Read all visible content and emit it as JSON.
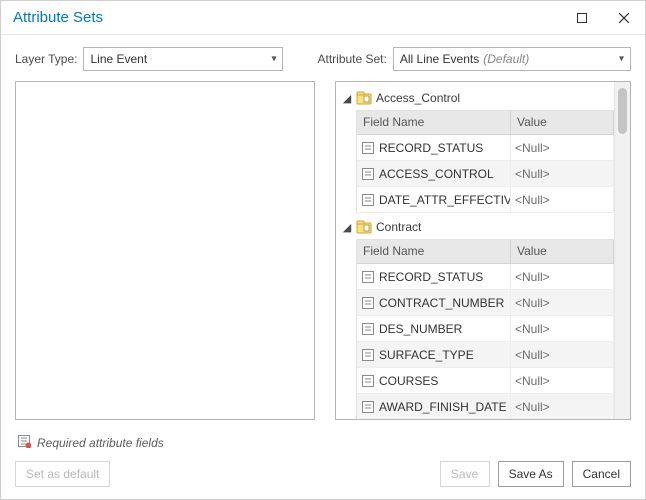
{
  "window": {
    "title": "Attribute Sets"
  },
  "controls": {
    "layer_type_label": "Layer Type:",
    "layer_type_value": "Line Event",
    "attribute_set_label": "Attribute Set:",
    "attribute_set_value": "All Line Events",
    "attribute_set_default": "(Default)"
  },
  "tree": {
    "groups": [
      {
        "name": "Access_Control",
        "header_field": "Field Name",
        "header_value": "Value",
        "rows": [
          {
            "field": "RECORD_STATUS",
            "value": "<Null>"
          },
          {
            "field": "ACCESS_CONTROL",
            "value": "<Null>"
          },
          {
            "field": "DATE_ATTR_EFFECTIVE",
            "value": "<Null>"
          }
        ]
      },
      {
        "name": "Contract",
        "header_field": "Field Name",
        "header_value": "Value",
        "rows": [
          {
            "field": "RECORD_STATUS",
            "value": "<Null>"
          },
          {
            "field": "CONTRACT_NUMBER",
            "value": "<Null>"
          },
          {
            "field": "DES_NUMBER",
            "value": "<Null>"
          },
          {
            "field": "SURFACE_TYPE",
            "value": "<Null>"
          },
          {
            "field": "COURSES",
            "value": "<Null>"
          },
          {
            "field": "AWARD_FINISH_DATE",
            "value": "<Null>"
          }
        ]
      }
    ]
  },
  "footer": {
    "required_text": "Required attribute fields",
    "set_default": "Set as default",
    "save": "Save",
    "save_as": "Save As",
    "cancel": "Cancel"
  }
}
